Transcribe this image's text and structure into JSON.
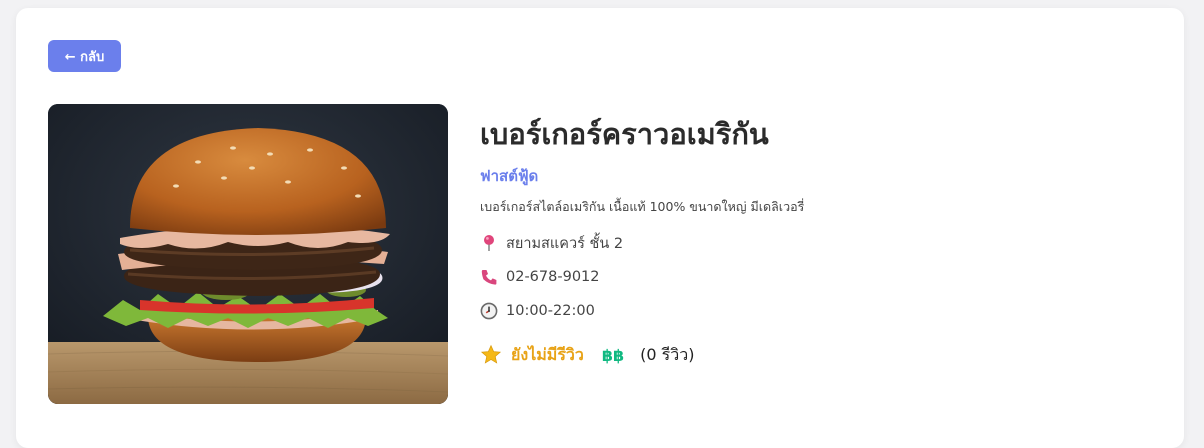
{
  "back_button": {
    "label": "← กลับ"
  },
  "restaurant": {
    "name": "เบอร์เกอร์คราวอเมริกัน",
    "category": "ฟาสต์ฟู้ด",
    "description": "เบอร์เกอร์สไตล์อเมริกัน เนื้อแท้ 100% ขนาดใหญ่ มีเดลิเวอรี่",
    "location": "สยามสแควร์ ชั้น 2",
    "phone": "02-678-9012",
    "hours": "10:00-22:00",
    "rating_text": "ยังไม่มีรีวิว",
    "price_level": "฿฿",
    "review_count": "(0 รีวิว)"
  },
  "icons": {
    "location": "pin-icon",
    "phone": "phone-icon",
    "hours": "clock-icon",
    "rating": "star-icon"
  },
  "colors": {
    "accent": "#6b7fec",
    "rating": "#e8a317",
    "price": "#10b981"
  }
}
